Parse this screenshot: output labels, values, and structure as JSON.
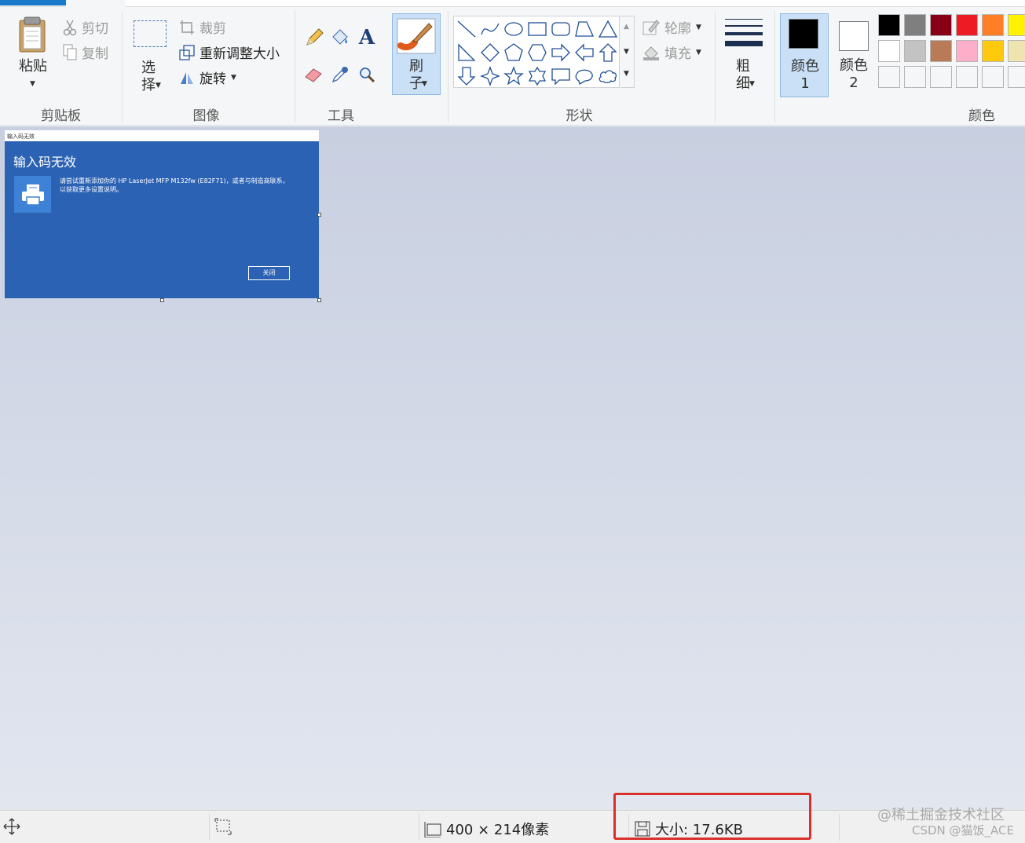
{
  "ribbon": {
    "clipboard": {
      "paste": "粘贴",
      "cut": "剪切",
      "copy": "复制",
      "group": "剪贴板"
    },
    "image": {
      "select": "选择",
      "crop": "裁剪",
      "resize": "重新调整大小",
      "rotate": "旋转",
      "group": "图像"
    },
    "tools": {
      "group": "工具",
      "text_glyph": "A"
    },
    "brushes": {
      "label": "刷子"
    },
    "shapes": {
      "outline": "轮廓",
      "fill": "填充",
      "group": "形状"
    },
    "size": {
      "label": "粗细"
    },
    "colors": {
      "color1": "颜色 1",
      "color2": "颜色 2",
      "group": "颜色",
      "color1_value": "#000000",
      "color2_value": "#ffffff",
      "palette_row1": [
        "#000000",
        "#7f7f7f",
        "#880015",
        "#ed1c24",
        "#ff7f27",
        "#fff200"
      ],
      "palette_row2": [
        "#ffffff",
        "#c3c3c3",
        "#b97a57",
        "#ffaec9",
        "#ffc90e",
        "#efe4b0"
      ]
    }
  },
  "canvas": {
    "window_title": "输入码无效",
    "dialog_title": "输入码无效",
    "message_line1": "请尝试重新添加你的 HP LaserJet MFP M132fw (E82F71)，或者与制造商联系，",
    "message_line2": "以获取更多设置说明。",
    "close_button": "关闭",
    "accent": "#2b62b3"
  },
  "status": {
    "dimensions": "400 × 214像素",
    "file_size": "大小: 17.6KB"
  },
  "watermark": {
    "line1": "@稀土掘金技术社区",
    "line2": "CSDN @猫饭_ACE"
  }
}
